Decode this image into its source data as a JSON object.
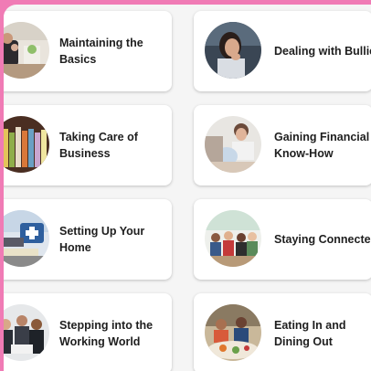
{
  "topics": [
    {
      "label": "Maintaining the Basics",
      "image": "family-at-home-photo"
    },
    {
      "label": "Dealing with Bullies",
      "image": "worried-woman-photo"
    },
    {
      "label": "Taking Care of Business",
      "image": "file-folders-photo"
    },
    {
      "label": "Gaining Financial Know-How",
      "image": "piggy-bank-photo"
    },
    {
      "label": "Setting Up Your Home",
      "image": "medical-supplies-photo"
    },
    {
      "label": "Staying Connected",
      "image": "group-meeting-photo"
    },
    {
      "label": "Stepping into the Working World",
      "image": "office-team-photo"
    },
    {
      "label": "Eating In and Dining Out",
      "image": "dining-together-photo"
    }
  ],
  "colors": {
    "page_border": "#f07bb5",
    "background": "#f5f5f5",
    "card": "#ffffff",
    "text": "#1e1e1e"
  }
}
